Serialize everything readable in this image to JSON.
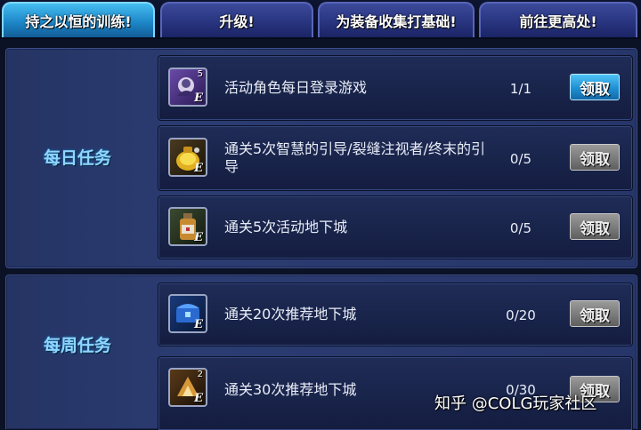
{
  "tabs": [
    {
      "label": "持之以恒的训练!",
      "active": true
    },
    {
      "label": "升级!",
      "active": false
    },
    {
      "label": "为装备收集打基础!",
      "active": false
    },
    {
      "label": "前往更高处!",
      "active": false
    }
  ],
  "daily": {
    "title": "每日任务",
    "quests": [
      {
        "icon": "character-portrait-icon",
        "count_badge": "5",
        "grade": "E",
        "text": "活动角色每日登录游戏",
        "progress": "1/1",
        "button": "领取",
        "button_enabled": true
      },
      {
        "icon": "gold-pouch-icon",
        "count_badge": "",
        "grade": "E",
        "text": "通关5次智慧的引导/裂缝注视者/终末的引导",
        "progress": "0/5",
        "button": "领取",
        "button_enabled": false
      },
      {
        "icon": "potion-bottle-icon",
        "count_badge": "",
        "grade": "E",
        "text": "通关5次活动地下城",
        "progress": "0/5",
        "button": "领取",
        "button_enabled": false
      }
    ]
  },
  "weekly": {
    "title": "每周任务",
    "quests": [
      {
        "icon": "blue-chest-icon",
        "count_badge": "",
        "grade": "E",
        "text": "通关20次推荐地下城",
        "progress": "0/20",
        "button": "领取",
        "button_enabled": false
      },
      {
        "icon": "golden-box-icon",
        "count_badge": "2",
        "grade": "E",
        "text": "通关30次推荐地下城",
        "progress": "0/30",
        "button": "领取",
        "button_enabled": false
      }
    ]
  },
  "watermark": "知乎 @COLG玩家社区"
}
